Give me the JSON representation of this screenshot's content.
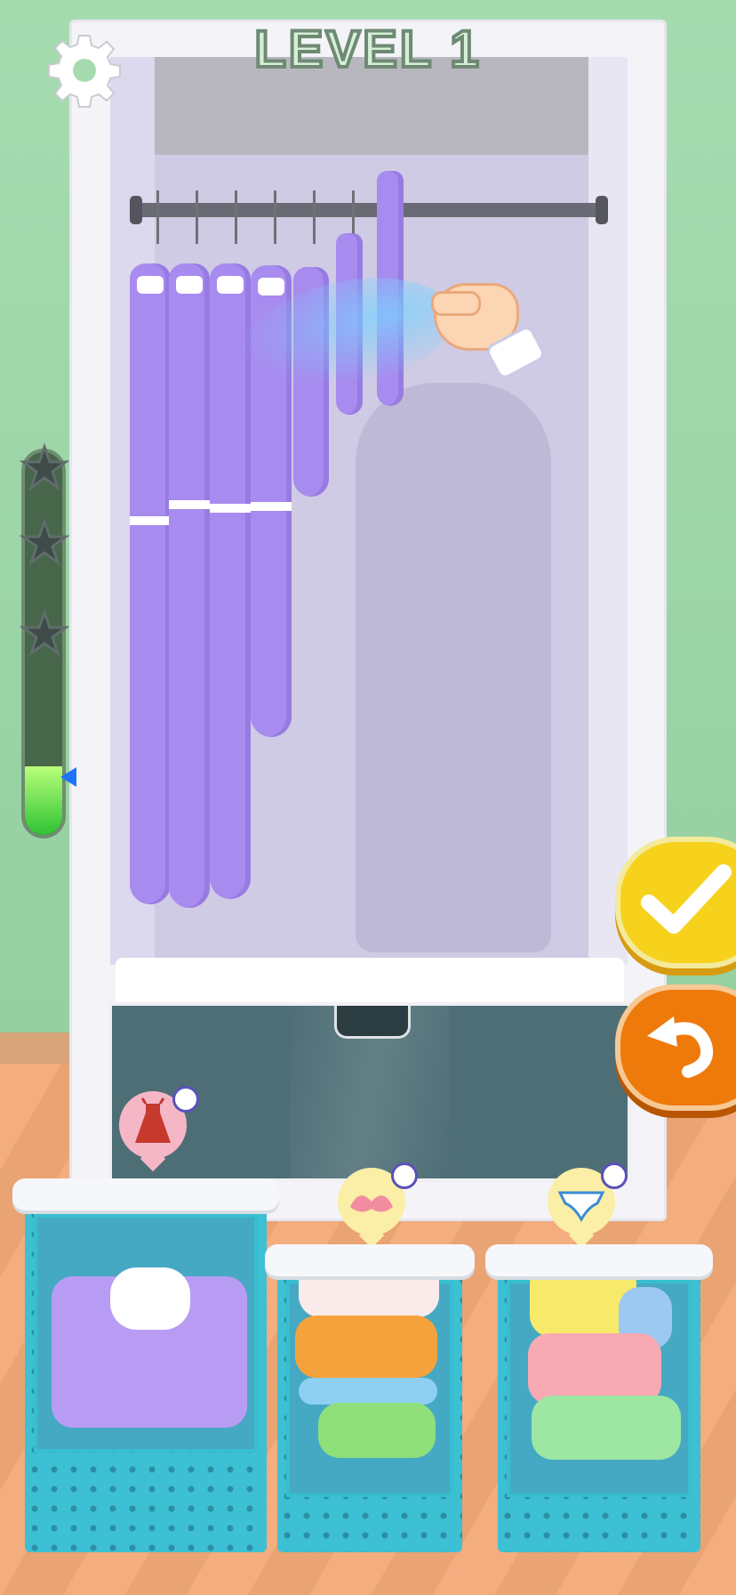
{
  "header": {
    "title": "LEVEL 1"
  },
  "icons": {
    "settings": "gear-icon",
    "confirm": "checkmark-icon",
    "undo": "undo-arrow-icon",
    "star": "star-icon",
    "dress": "dress-icon",
    "bra": "bra-icon",
    "underwear": "underwear-icon",
    "hanger": "hanger-icon",
    "folded": "folded-icon",
    "tutorial_hand": "pointing-hand-icon"
  },
  "progress": {
    "fill_fraction": 0.18,
    "stars_total": 3,
    "stars_earned": 0
  },
  "colors": {
    "garment": "#a88bef",
    "confirm_button": "#f7d21c",
    "undo_button": "#ee7a0c",
    "basket": "#3ec0d4",
    "progress_fill": "#2dc334"
  }
}
